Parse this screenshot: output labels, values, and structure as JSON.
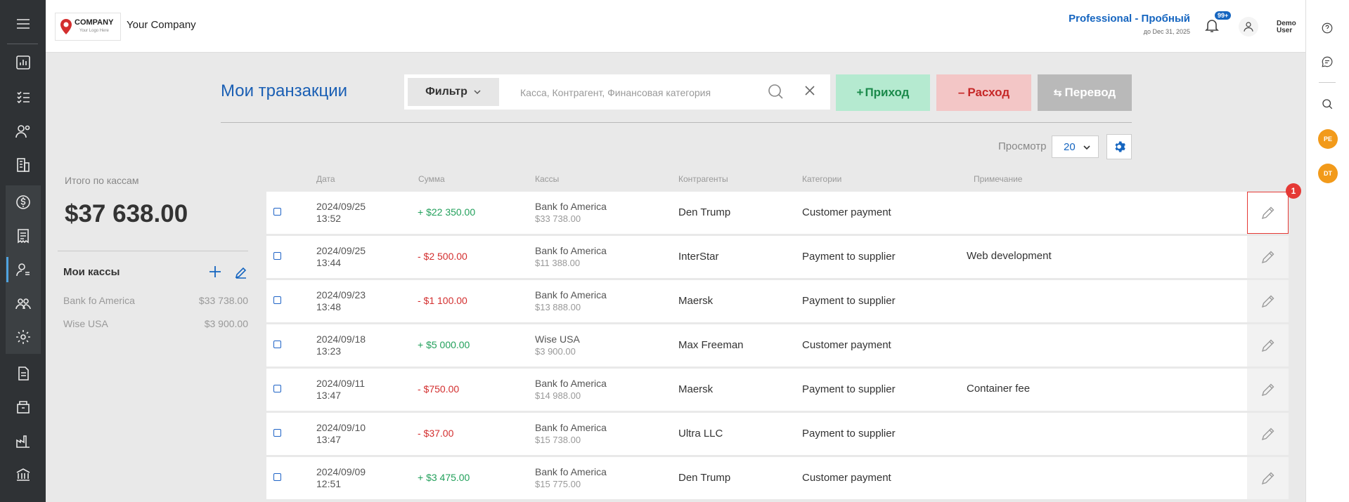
{
  "header": {
    "logo_text": "COMPANY",
    "logo_sub": "Your Logo Here",
    "company_name": "Your Company",
    "plan": "Professional - Пробный",
    "plan_date": "до Dec 31, 2025",
    "notifications_badge": "99+",
    "user_name": "Demo User"
  },
  "sidebar": {
    "icons": [
      "menu-icon",
      "dashboard-icon",
      "checklist-icon",
      "users-search-icon",
      "building-icon",
      "money-circle-icon",
      "receipt-icon",
      "user-money-icon",
      "group-icon",
      "settings-user-icon",
      "document-icon",
      "box-icon",
      "factory-icon",
      "bank-icon"
    ]
  },
  "rightbar": {
    "avatars": [
      "PE",
      "DT"
    ]
  },
  "main": {
    "title": "Мои транзакции",
    "filter_label": "Фильтр",
    "search_placeholder": "Касса, Контрагент, Финансовая категория",
    "income_label": "Приход",
    "expense_label": "Расход",
    "transfer_label": "Перевод",
    "view_label": "Просмотр",
    "view_value": "20"
  },
  "summary": {
    "label": "Итого по кассам",
    "total": "$37 638.00",
    "kassy_title": "Мои кассы",
    "kassy": [
      {
        "name": "Bank fo America",
        "amount": "$33 738.00"
      },
      {
        "name": "Wise USA",
        "amount": "$3 900.00"
      }
    ]
  },
  "table": {
    "headers": [
      "Дата",
      "Сумма",
      "Кассы",
      "Контрагенты",
      "Категории",
      "Примечание"
    ],
    "edit_badge": "1",
    "rows": [
      {
        "date": "2024/09/25",
        "time": "13:52",
        "amount": "+ $22 350.00",
        "type": "pos",
        "kassa": "Bank fo America",
        "balance": "$33 738.00",
        "contr": "Den Trump",
        "cat": "Customer payment",
        "note": ""
      },
      {
        "date": "2024/09/25",
        "time": "13:44",
        "amount": "- $2 500.00",
        "type": "neg",
        "kassa": "Bank fo America",
        "balance": "$11 388.00",
        "contr": "InterStar",
        "cat": "Payment to supplier",
        "note": "Web development"
      },
      {
        "date": "2024/09/23",
        "time": "13:48",
        "amount": "- $1 100.00",
        "type": "neg",
        "kassa": "Bank fo America",
        "balance": "$13 888.00",
        "contr": "Maersk",
        "cat": "Payment to supplier",
        "note": ""
      },
      {
        "date": "2024/09/18",
        "time": "13:23",
        "amount": "+ $5 000.00",
        "type": "pos",
        "kassa": "Wise USA",
        "balance": "$3 900.00",
        "contr": "Max Freeman",
        "cat": "Customer payment",
        "note": ""
      },
      {
        "date": "2024/09/11",
        "time": "13:47",
        "amount": "- $750.00",
        "type": "neg",
        "kassa": "Bank fo America",
        "balance": "$14 988.00",
        "contr": "Maersk",
        "cat": "Payment to supplier",
        "note": "Container fee"
      },
      {
        "date": "2024/09/10",
        "time": "13:47",
        "amount": "- $37.00",
        "type": "neg",
        "kassa": "Bank fo America",
        "balance": "$15 738.00",
        "contr": "Ultra LLC",
        "cat": "Payment to supplier",
        "note": ""
      },
      {
        "date": "2024/09/09",
        "time": "12:51",
        "amount": "+ $3 475.00",
        "type": "pos",
        "kassa": "Bank fo America",
        "balance": "$15 775.00",
        "contr": "Den Trump",
        "cat": "Customer payment",
        "note": ""
      }
    ]
  },
  "colors": {
    "accent": "#1a5fb4",
    "income": "#22a05b",
    "expense": "#d32f2f",
    "sidebar": "#2f3235"
  }
}
